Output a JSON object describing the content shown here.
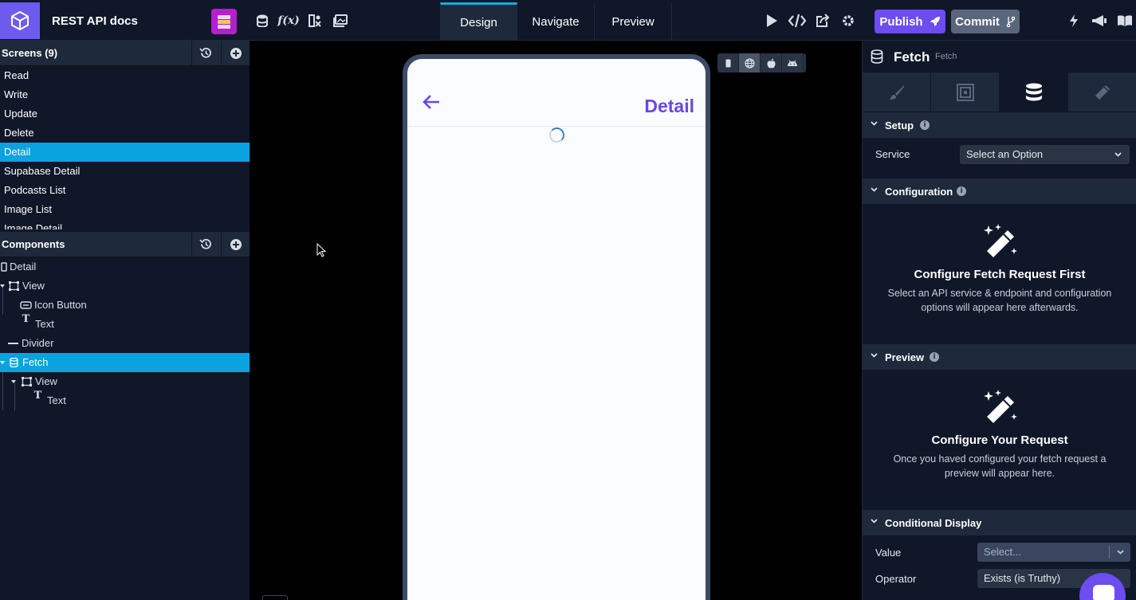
{
  "app": {
    "title": "REST API docs",
    "colors": {
      "accent": "#6d4cf0",
      "selection": "#0aa3e0",
      "panel": "#0f1729",
      "panel_head": "#1e293b"
    }
  },
  "topbar": {
    "tool_icons": [
      "database-icon",
      "function-icon",
      "assets-icon",
      "media-icon"
    ],
    "tabs": [
      {
        "label": "Design",
        "active": true
      },
      {
        "label": "Navigate",
        "active": false
      },
      {
        "label": "Preview",
        "active": false
      }
    ],
    "actions": [
      "play-icon",
      "code-icon",
      "share-icon",
      "gear-icon"
    ],
    "publish_label": "Publish",
    "commit_label": "Commit",
    "far_right": [
      "bolt-icon",
      "megaphone-icon",
      "book-icon"
    ]
  },
  "screens": {
    "header": "Screens (9)",
    "items": [
      "Read",
      "Write",
      "Update",
      "Delete",
      "Detail",
      "Supabase Detail",
      "Podcasts List",
      "Image List",
      "Image Detail"
    ],
    "selected": "Detail"
  },
  "components": {
    "header": "Components",
    "tree": [
      {
        "label": "Detail",
        "icon": "screen-icon"
      },
      {
        "label": "View",
        "icon": "view-icon"
      },
      {
        "label": "Icon Button",
        "icon": "button-icon"
      },
      {
        "label": "Text",
        "icon": "text-icon"
      },
      {
        "label": "Divider",
        "icon": "divider-icon"
      },
      {
        "label": "Fetch",
        "icon": "database-icon",
        "selected": true
      },
      {
        "label": "View",
        "icon": "view-icon"
      },
      {
        "label": "Text",
        "icon": "text-icon"
      }
    ]
  },
  "canvas": {
    "screen_title": "Detail",
    "platforms": [
      "phone-icon",
      "web-icon",
      "apple-icon",
      "android-icon"
    ]
  },
  "panel": {
    "title": "Fetch",
    "subtitle": "Fetch",
    "tabs": [
      "brush-icon",
      "layout-icon",
      "database-icon",
      "magic-wand-icon"
    ],
    "setup": {
      "label": "Setup",
      "service_label": "Service",
      "service_value": "Select an Option"
    },
    "configuration": {
      "label": "Configuration",
      "heading": "Configure Fetch Request First",
      "body": "Select an API service & endpoint and configuration options will appear here afterwards."
    },
    "preview": {
      "label": "Preview",
      "heading": "Configure Your Request",
      "body": "Once you haved configured your fetch request a preview will appear here."
    },
    "conditional": {
      "label": "Conditional Display",
      "value_label": "Value",
      "value_placeholder": "Select...",
      "operator_label": "Operator",
      "operator_value": "Exists (is Truthy)"
    }
  }
}
